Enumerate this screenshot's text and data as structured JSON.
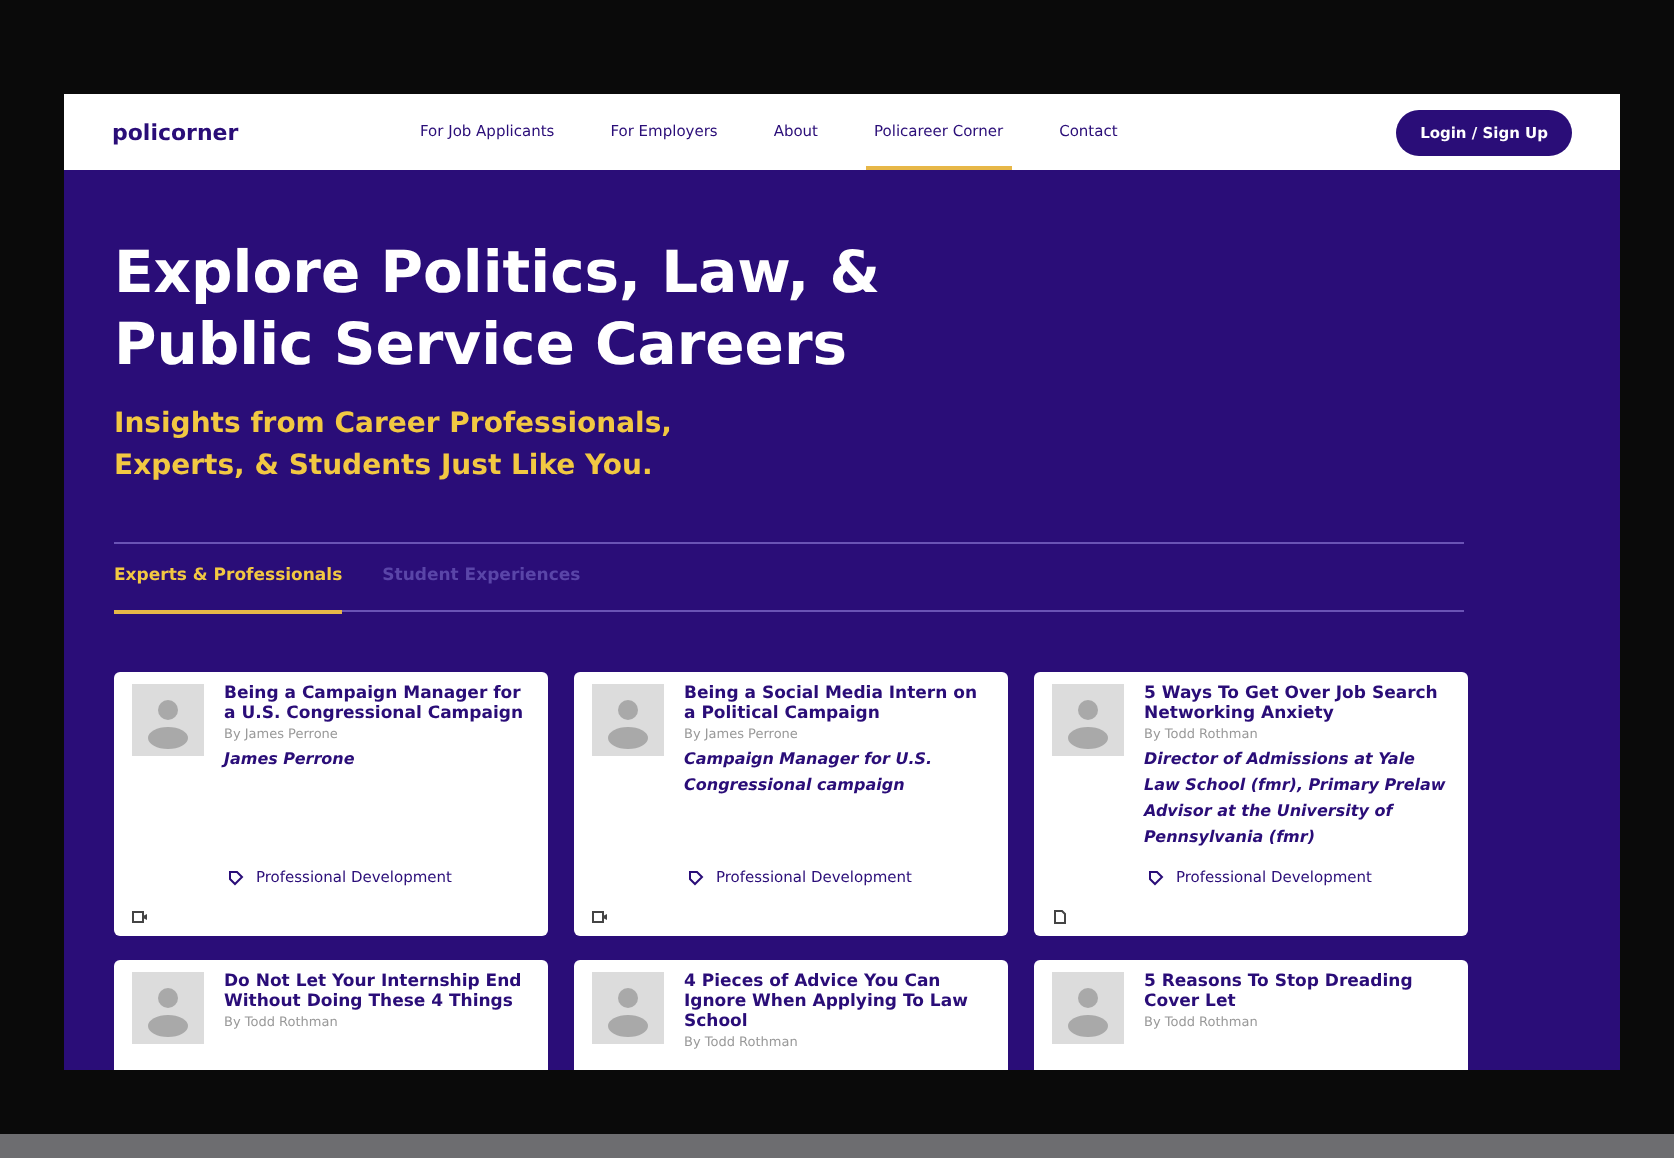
{
  "nav": {
    "logo": "policorner",
    "links": [
      {
        "label": "For Job Applicants",
        "selected": false
      },
      {
        "label": "For Employers",
        "selected": false
      },
      {
        "label": "About",
        "selected": false
      },
      {
        "label": "Policareer Corner",
        "selected": true
      },
      {
        "label": "Contact",
        "selected": false
      }
    ],
    "button": "Login / Sign Up"
  },
  "hero": {
    "title": "Explore Politics, Law, & Public Service Careers",
    "subtitle": "Insights from Career Professionals, Experts, & Students Just Like You."
  },
  "tabs": [
    {
      "label": "Experts & Professionals",
      "selected": true
    },
    {
      "label": "Student Experiences",
      "selected": false
    }
  ],
  "cards": [
    {
      "title": "Being a Campaign Manager for a U.S. Congressional Campaign",
      "author": "By James Perrone",
      "role": "James Perrone",
      "tag": "Professional Development",
      "kind": "video"
    },
    {
      "title": "Being a Social Media Intern on a Political Campaign",
      "author": "By James Perrone",
      "role": "Campaign Manager for U.S. Congressional campaign",
      "tag": "Professional Development",
      "kind": "video"
    },
    {
      "title": "5 Ways To Get Over Job Search Networking Anxiety",
      "author": "By Todd Rothman",
      "role": "Director of Admissions at Yale Law School (fmr), Primary Prelaw Advisor at the University of Pennsylvania (fmr)",
      "tag": "Professional Development",
      "kind": "document"
    },
    {
      "title": "Do Not Let Your Internship End Without Doing These 4 Things",
      "author": "By Todd Rothman"
    },
    {
      "title": "4 Pieces of Advice You Can Ignore When Applying To Law School",
      "author": "By Todd Rothman"
    },
    {
      "title": "5 Reasons To Stop Dreading Cover Let",
      "author": "By Todd Rothman"
    }
  ]
}
